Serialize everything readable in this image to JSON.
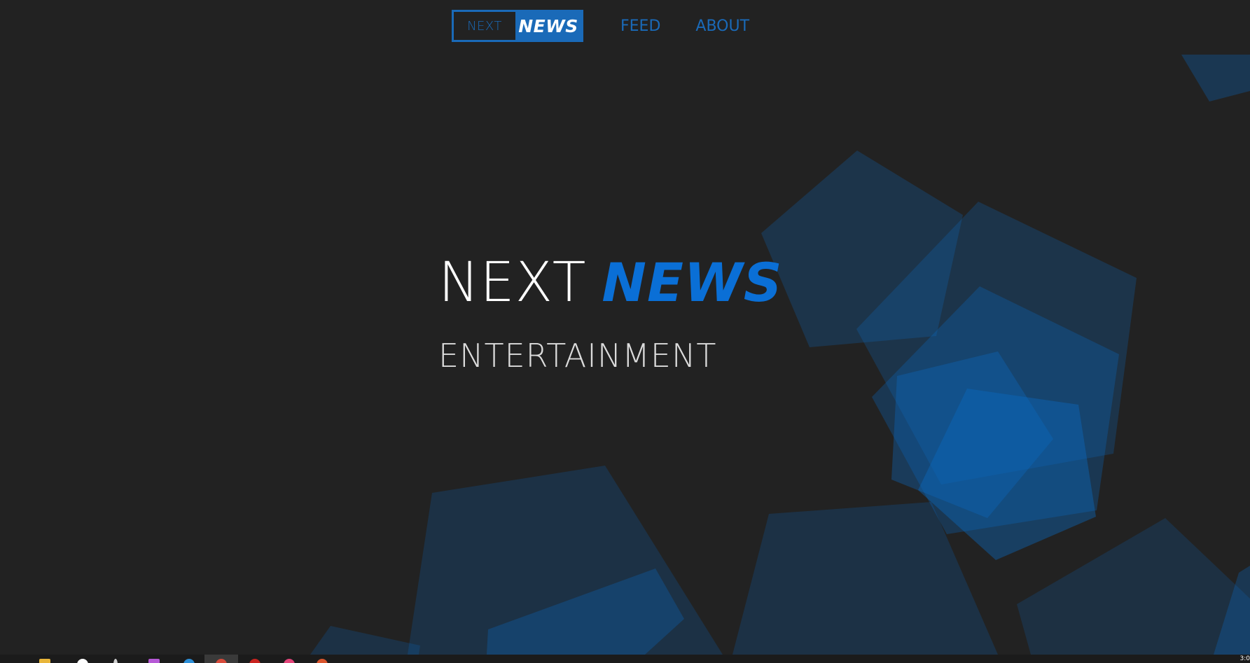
{
  "nav": {
    "logo_next": "NEXT",
    "logo_news": "NEWS",
    "links": [
      {
        "label": "FEED"
      },
      {
        "label": "ABOUT"
      }
    ]
  },
  "hero": {
    "title_next": "NEXT",
    "title_news": "NEWS",
    "subtitle": "ENTERTAINMENT"
  },
  "taskbar": {
    "clock": "3:0"
  },
  "colors": {
    "background": "#222222",
    "accent": "#1a6ab8",
    "hero_accent": "#0a6fd6",
    "shape_fill": "#1a4f7f"
  }
}
